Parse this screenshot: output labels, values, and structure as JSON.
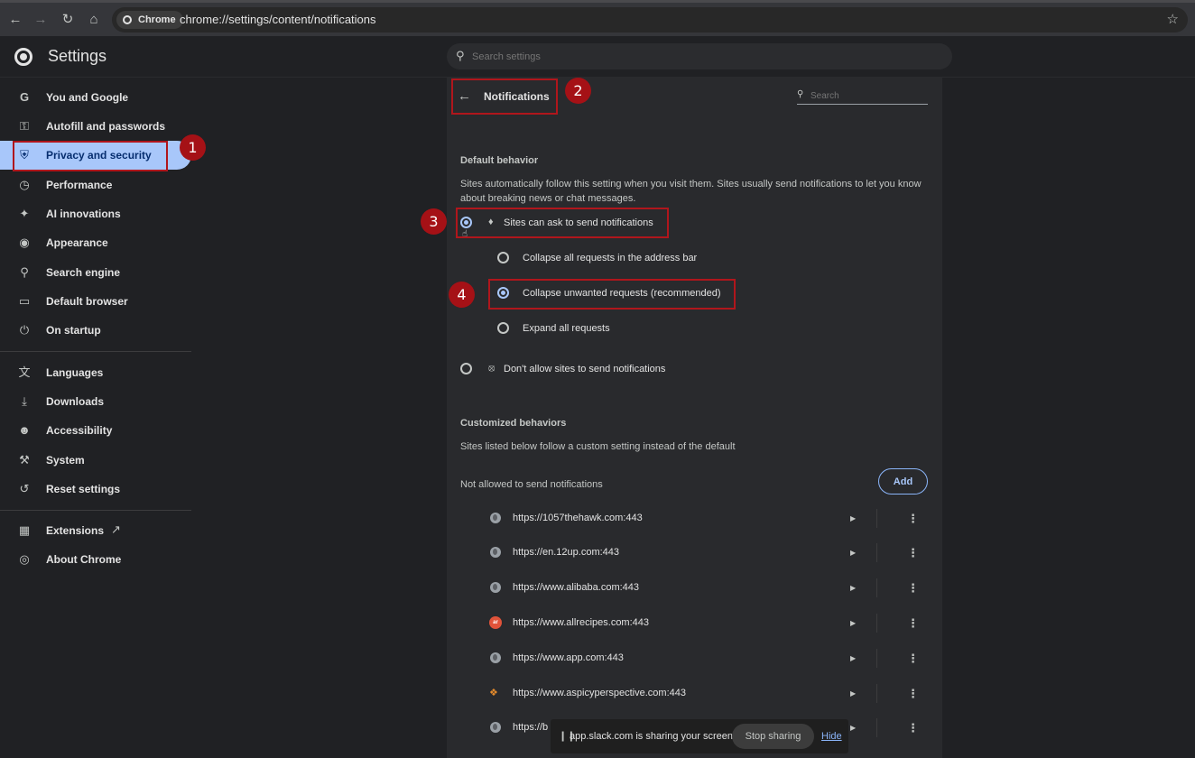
{
  "browser": {
    "chip_label": "Chrome",
    "url": "chrome://settings/content/notifications"
  },
  "header": {
    "title": "Settings",
    "search_placeholder": "Search settings"
  },
  "sidebar": {
    "items": [
      {
        "label": "You and Google",
        "icon": "google-g-icon"
      },
      {
        "label": "Autofill and passwords",
        "icon": "key-icon"
      },
      {
        "label": "Privacy and security",
        "icon": "shield-icon"
      },
      {
        "label": "Performance",
        "icon": "speedometer-icon"
      },
      {
        "label": "AI innovations",
        "icon": "sparkle-icon"
      },
      {
        "label": "Appearance",
        "icon": "palette-icon"
      },
      {
        "label": "Search engine",
        "icon": "search-icon"
      },
      {
        "label": "Default browser",
        "icon": "browser-window-icon"
      },
      {
        "label": "On startup",
        "icon": "power-icon"
      },
      {
        "label": "Languages",
        "icon": "translate-icon"
      },
      {
        "label": "Downloads",
        "icon": "download-icon"
      },
      {
        "label": "Accessibility",
        "icon": "accessibility-icon"
      },
      {
        "label": "System",
        "icon": "wrench-icon"
      },
      {
        "label": "Reset settings",
        "icon": "reset-icon"
      },
      {
        "label": "Extensions",
        "icon": "puzzle-icon"
      },
      {
        "label": "About Chrome",
        "icon": "chrome-logo-icon"
      }
    ]
  },
  "notifications": {
    "title": "Notifications",
    "search_placeholder": "Search",
    "default_behavior": {
      "title": "Default behavior",
      "description": "Sites automatically follow this setting when you visit them. Sites usually send notifications to let you know about breaking news or chat messages.",
      "options": {
        "ask": "Sites can ask to send notifications",
        "collapse_all": "Collapse all requests in the address bar",
        "collapse_unwanted": "Collapse unwanted requests (recommended)",
        "expand_all": "Expand all requests",
        "block": "Don't allow sites to send notifications"
      }
    },
    "customized": {
      "title": "Customized behaviors",
      "description": "Sites listed below follow a custom setting instead of the default",
      "not_allowed_label": "Not allowed to send notifications",
      "add_label": "Add",
      "sites": [
        "https://1057thehawk.com:443",
        "https://en.12up.com:443",
        "https://www.alibaba.com:443",
        "https://www.allrecipes.com:443",
        "https://www.app.com:443",
        "https://www.aspicyperspective.com:443",
        "https://b"
      ]
    }
  },
  "annotations": [
    "1",
    "2",
    "3",
    "4"
  ],
  "share_bar": {
    "message": "app.slack.com is sharing your screen.",
    "stop_label": "Stop sharing",
    "hide_label": "Hide"
  }
}
